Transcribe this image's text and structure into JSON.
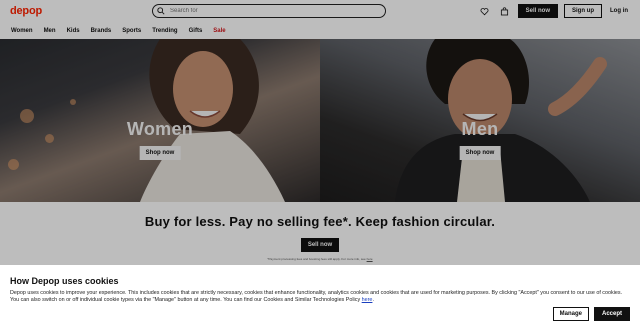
{
  "header": {
    "logo": "depop",
    "search_placeholder": "Search for",
    "sell_now": "Sell now",
    "sign_up": "Sign up",
    "log_in": "Log in"
  },
  "nav": [
    "Women",
    "Men",
    "Kids",
    "Brands",
    "Sports",
    "Trending",
    "Gifts",
    "Sale"
  ],
  "hero": {
    "women": {
      "title": "Women",
      "button": "Shop now"
    },
    "men": {
      "title": "Men",
      "button": "Shop now"
    }
  },
  "promo": {
    "headline": "Buy for less. Pay no selling fee*. Keep fashion circular.",
    "button": "Sell now",
    "fineprint": "*Payment processing fees and boosting fees still apply. For more info, see",
    "fineprint_link": "here"
  },
  "cookie": {
    "title": "How Depop uses cookies",
    "body": "Depop uses cookies to improve your experience. This includes cookies that are strictly necessary, cookies that enhance functionality, analytics cookies and cookies that are used for marketing purposes. By clicking \"Accept\" you consent to our use of cookies. You can also switch on or off individual cookie types via the \"Manage\" button at any time. You can find our Cookies and Similar Technologies Policy",
    "link": "here",
    "manage": "Manage",
    "accept": "Accept"
  },
  "colors": {
    "brand": "#ff2300",
    "sale": "#d4151a",
    "link": "#1a3fbf"
  }
}
